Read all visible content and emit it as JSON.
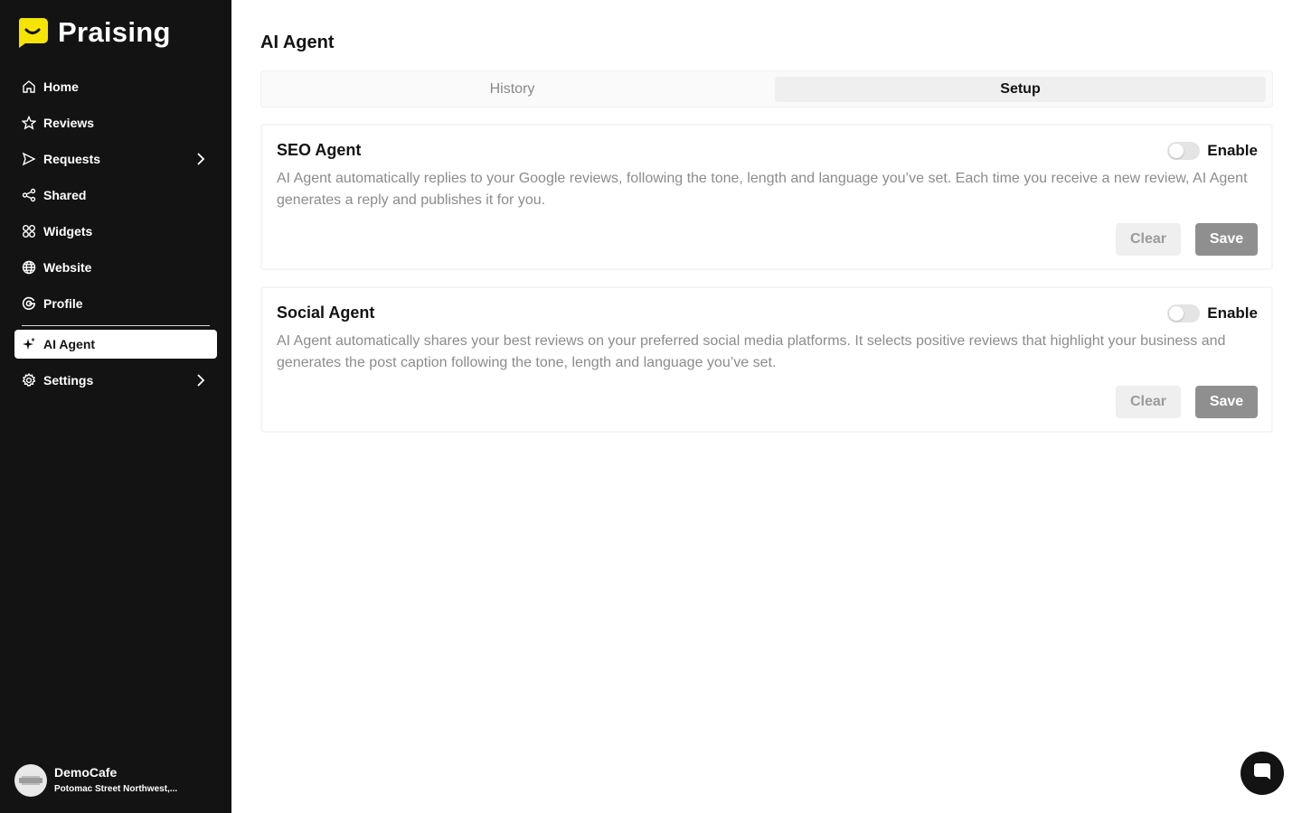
{
  "brand": {
    "name": "Praising",
    "accent": "#f5e400"
  },
  "sidebar": {
    "items": [
      {
        "label": "Home",
        "icon": "home-icon"
      },
      {
        "label": "Reviews",
        "icon": "star-icon"
      },
      {
        "label": "Requests",
        "icon": "send-icon",
        "has_submenu": true
      },
      {
        "label": "Shared",
        "icon": "share-icon"
      },
      {
        "label": "Widgets",
        "icon": "widgets-icon"
      },
      {
        "label": "Website",
        "icon": "globe-icon"
      },
      {
        "label": "Profile",
        "icon": "google-icon"
      },
      {
        "label": "AI Agent",
        "icon": "sparkle-icon",
        "active": true
      },
      {
        "label": "Settings",
        "icon": "gear-icon",
        "has_submenu": true
      }
    ],
    "account": {
      "name": "DemoCafe",
      "address": "Potomac Street Northwest,..."
    }
  },
  "main": {
    "title": "AI Agent",
    "tabs": [
      {
        "label": "History",
        "active": false
      },
      {
        "label": "Setup",
        "active": true
      }
    ],
    "cards": [
      {
        "title": "SEO Agent",
        "description": "AI Agent automatically replies to your Google reviews, following the tone, length and language you’ve set. Each time you receive a new review, AI Agent generates a reply and publishes it for you.",
        "toggle_label": "Enable",
        "enabled": false,
        "clear_label": "Clear",
        "save_label": "Save"
      },
      {
        "title": "Social Agent",
        "description": "AI Agent automatically shares your best reviews on your preferred social media platforms. It selects positive reviews that highlight your business and generates the post caption following the tone, length and language you’ve set.",
        "toggle_label": "Enable",
        "enabled": false,
        "clear_label": "Clear",
        "save_label": "Save"
      }
    ]
  },
  "chat": {
    "icon": "chat-icon"
  }
}
